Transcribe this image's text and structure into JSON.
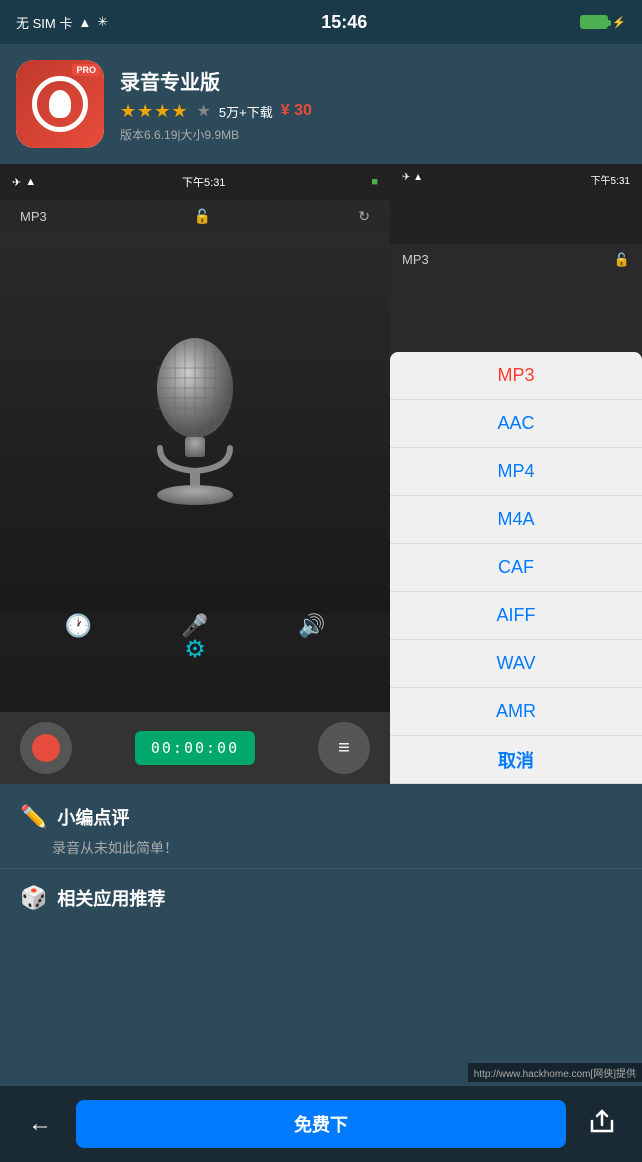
{
  "statusBar": {
    "carrier": "无 SIM 卡",
    "wifi": "WiFi",
    "signal": "※",
    "time": "15:46",
    "battery": "full"
  },
  "appHeader": {
    "name": "录音专业版",
    "stars": "★★★★",
    "starEmpty": "★",
    "ratingCount": "5万+下载",
    "price": "¥ 30",
    "version": "版本6.6.19|大小9.9MB",
    "proBadge": "PRO"
  },
  "screenshot": {
    "leftStatus": {
      "left": "✈ WiFi",
      "center": "下午5:31",
      "right": "● ■"
    },
    "rightStatus": {
      "left": "✈ WiFi",
      "center": "下午5:31"
    },
    "formatLabel": "MP3",
    "timer": "00:00:00",
    "formats": [
      {
        "label": "MP3",
        "selected": true
      },
      {
        "label": "AAC",
        "selected": false
      },
      {
        "label": "MP4",
        "selected": false
      },
      {
        "label": "M4A",
        "selected": false
      },
      {
        "label": "CAF",
        "selected": false
      },
      {
        "label": "AIFF",
        "selected": false
      },
      {
        "label": "WAV",
        "selected": false
      },
      {
        "label": "AMR",
        "selected": false
      }
    ],
    "cancelLabel": "取消"
  },
  "review": {
    "title": "小编点评",
    "text": "录音从未如此简单！",
    "icon": "✏️"
  },
  "related": {
    "title": "相关应用推荐",
    "icon": "🎲"
  },
  "bottomBar": {
    "back": "←",
    "download": "免费下",
    "share": "↗"
  },
  "watermark": "http://www.hackhome.com[网侠]提供"
}
